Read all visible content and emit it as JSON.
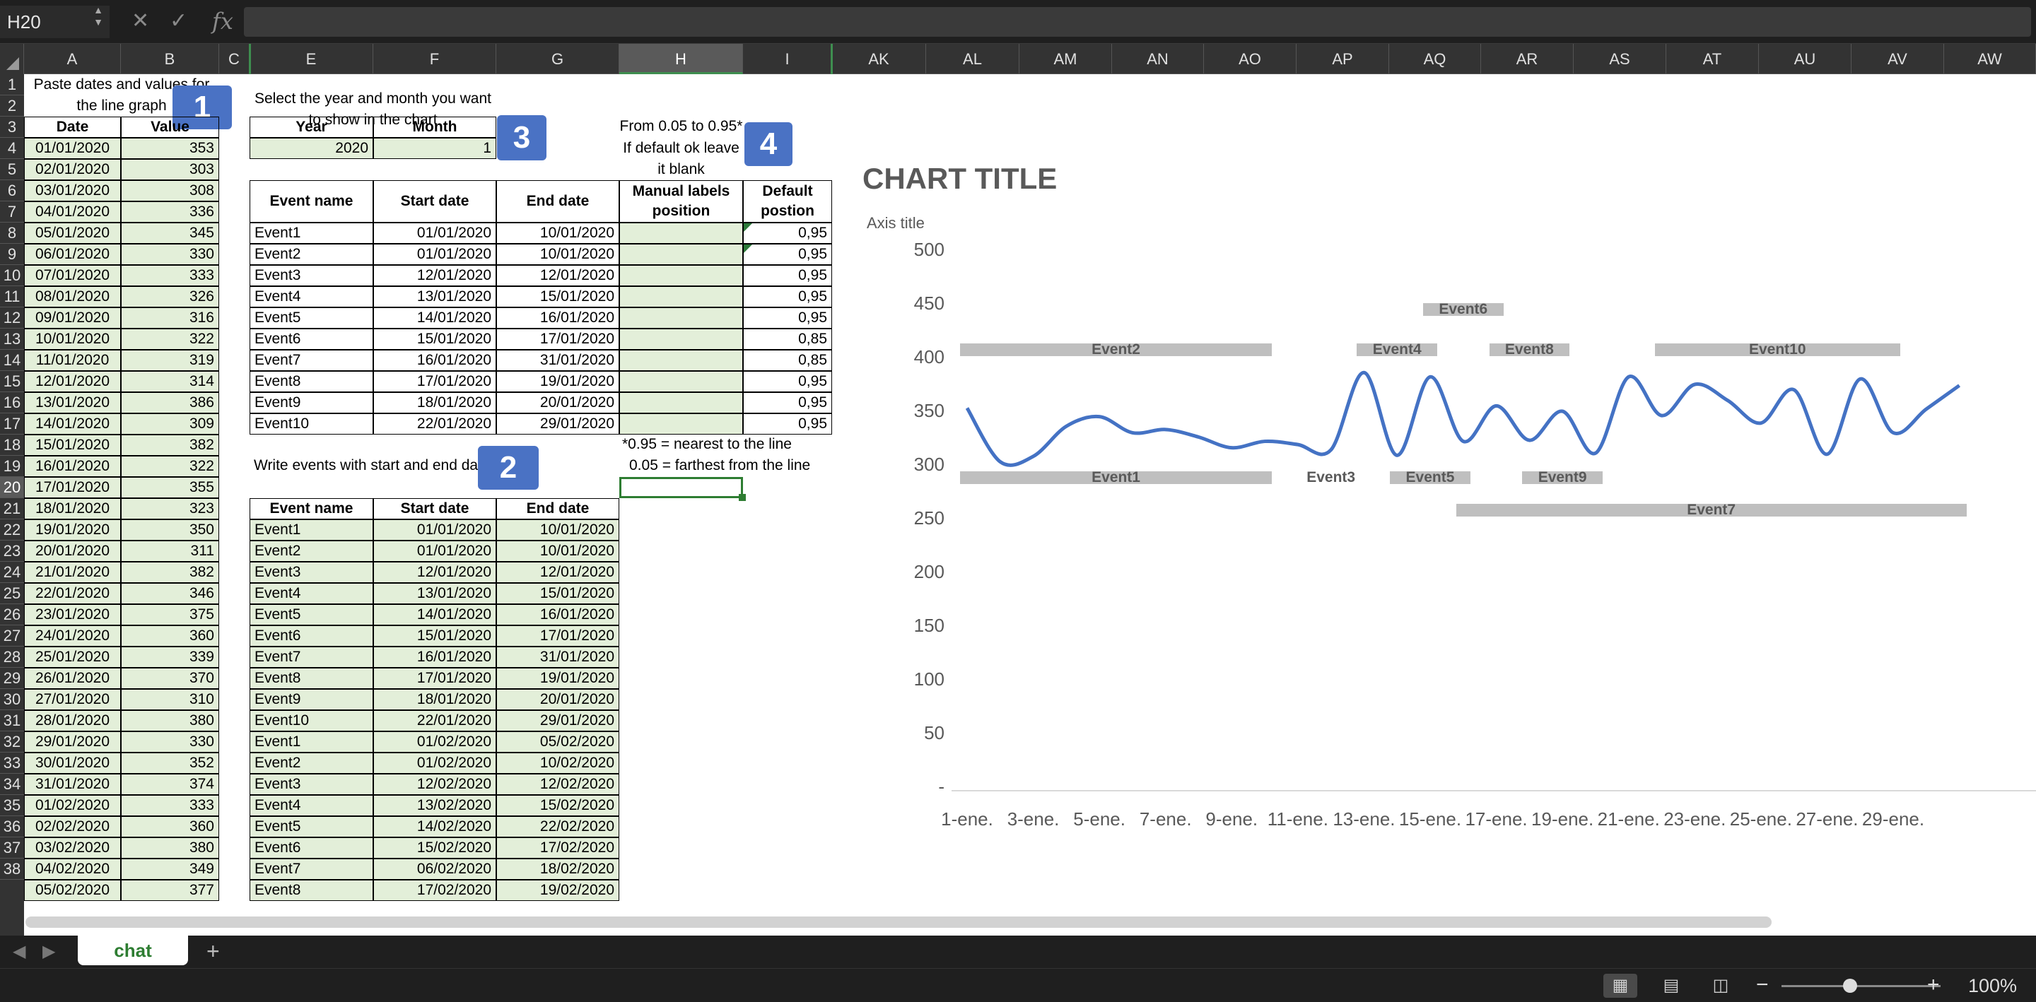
{
  "formula_bar": {
    "cell_ref": "H20",
    "fx_label": "fx",
    "cancel_icon": "close-icon",
    "enter_icon": "check-icon",
    "formula": ""
  },
  "columns": [
    "A",
    "B",
    "C",
    "E",
    "F",
    "G",
    "H",
    "I",
    "AK",
    "AL",
    "AM",
    "AN",
    "AO",
    "AP",
    "AQ",
    "AR",
    "AS",
    "AT",
    "AU",
    "AV",
    "AW"
  ],
  "selected_column": "H",
  "selected_row": "20",
  "rows": [
    "1",
    "2",
    "3",
    "4",
    "5",
    "6",
    "7",
    "8",
    "9",
    "10",
    "11",
    "12",
    "13",
    "14",
    "15",
    "16",
    "17",
    "18",
    "19",
    "20",
    "21",
    "22",
    "23",
    "24",
    "25",
    "26",
    "27",
    "28",
    "29",
    "30",
    "31",
    "32",
    "33",
    "34",
    "35",
    "36",
    "37",
    "38"
  ],
  "notes": {
    "paste_instructions": "Paste dates and values for the line graph",
    "select_instructions": "Select the year and month you want to show in the chart",
    "range_note": "From 0.05 to 0.95*",
    "default_note": "If default ok leave it blank",
    "nearest_note": "*0.95 = nearest to the line",
    "farthest_note": "0.05 = farthest from the line",
    "write_events": "Write events with start and end dat"
  },
  "badges": {
    "b1": "1",
    "b2": "2",
    "b3": "3",
    "b4": "4"
  },
  "data_table": {
    "headers": [
      "Date",
      "Value"
    ],
    "rows": [
      [
        "01/01/2020",
        "353"
      ],
      [
        "02/01/2020",
        "303"
      ],
      [
        "03/01/2020",
        "308"
      ],
      [
        "04/01/2020",
        "336"
      ],
      [
        "05/01/2020",
        "345"
      ],
      [
        "06/01/2020",
        "330"
      ],
      [
        "07/01/2020",
        "333"
      ],
      [
        "08/01/2020",
        "326"
      ],
      [
        "09/01/2020",
        "316"
      ],
      [
        "10/01/2020",
        "322"
      ],
      [
        "11/01/2020",
        "319"
      ],
      [
        "12/01/2020",
        "314"
      ],
      [
        "13/01/2020",
        "386"
      ],
      [
        "14/01/2020",
        "309"
      ],
      [
        "15/01/2020",
        "382"
      ],
      [
        "16/01/2020",
        "322"
      ],
      [
        "17/01/2020",
        "355"
      ],
      [
        "18/01/2020",
        "323"
      ],
      [
        "19/01/2020",
        "350"
      ],
      [
        "20/01/2020",
        "311"
      ],
      [
        "21/01/2020",
        "382"
      ],
      [
        "22/01/2020",
        "346"
      ],
      [
        "23/01/2020",
        "375"
      ],
      [
        "24/01/2020",
        "360"
      ],
      [
        "25/01/2020",
        "339"
      ],
      [
        "26/01/2020",
        "370"
      ],
      [
        "27/01/2020",
        "310"
      ],
      [
        "28/01/2020",
        "380"
      ],
      [
        "29/01/2020",
        "330"
      ],
      [
        "30/01/2020",
        "352"
      ],
      [
        "31/01/2020",
        "374"
      ],
      [
        "01/02/2020",
        "333"
      ],
      [
        "02/02/2020",
        "360"
      ],
      [
        "03/02/2020",
        "380"
      ],
      [
        "04/02/2020",
        "349"
      ],
      [
        "05/02/2020",
        "377"
      ]
    ]
  },
  "period": {
    "headers": [
      "Year",
      "Month"
    ],
    "year": "2020",
    "month": "1"
  },
  "events_chart_table": {
    "headers": [
      "Event name",
      "Start date",
      "End date",
      "Manual labels position",
      "Default postion"
    ],
    "rows": [
      [
        "Event1",
        "01/01/2020",
        "10/01/2020",
        "",
        "0,95"
      ],
      [
        "Event2",
        "01/01/2020",
        "10/01/2020",
        "",
        "0,95"
      ],
      [
        "Event3",
        "12/01/2020",
        "12/01/2020",
        "",
        "0,95"
      ],
      [
        "Event4",
        "13/01/2020",
        "15/01/2020",
        "",
        "0,95"
      ],
      [
        "Event5",
        "14/01/2020",
        "16/01/2020",
        "",
        "0,95"
      ],
      [
        "Event6",
        "15/01/2020",
        "17/01/2020",
        "",
        "0,85"
      ],
      [
        "Event7",
        "16/01/2020",
        "31/01/2020",
        "",
        "0,85"
      ],
      [
        "Event8",
        "17/01/2020",
        "19/01/2020",
        "",
        "0,95"
      ],
      [
        "Event9",
        "18/01/2020",
        "20/01/2020",
        "",
        "0,95"
      ],
      [
        "Event10",
        "22/01/2020",
        "29/01/2020",
        "",
        "0,95"
      ]
    ]
  },
  "events_input_table": {
    "headers": [
      "Event name",
      "Start date",
      "End date"
    ],
    "rows": [
      [
        "Event1",
        "01/01/2020",
        "10/01/2020"
      ],
      [
        "Event2",
        "01/01/2020",
        "10/01/2020"
      ],
      [
        "Event3",
        "12/01/2020",
        "12/01/2020"
      ],
      [
        "Event4",
        "13/01/2020",
        "15/01/2020"
      ],
      [
        "Event5",
        "14/01/2020",
        "16/01/2020"
      ],
      [
        "Event6",
        "15/01/2020",
        "17/01/2020"
      ],
      [
        "Event7",
        "16/01/2020",
        "31/01/2020"
      ],
      [
        "Event8",
        "17/01/2020",
        "19/01/2020"
      ],
      [
        "Event9",
        "18/01/2020",
        "20/01/2020"
      ],
      [
        "Event10",
        "22/01/2020",
        "29/01/2020"
      ],
      [
        "Event1",
        "01/02/2020",
        "05/02/2020"
      ],
      [
        "Event2",
        "01/02/2020",
        "10/02/2020"
      ],
      [
        "Event3",
        "12/02/2020",
        "12/02/2020"
      ],
      [
        "Event4",
        "13/02/2020",
        "15/02/2020"
      ],
      [
        "Event5",
        "14/02/2020",
        "22/02/2020"
      ],
      [
        "Event6",
        "15/02/2020",
        "17/02/2020"
      ],
      [
        "Event7",
        "06/02/2020",
        "18/02/2020"
      ],
      [
        "Event8",
        "17/02/2020",
        "19/02/2020"
      ]
    ]
  },
  "chart_data": {
    "type": "line",
    "title": "CHART TITLE",
    "ylabel": "Axis title",
    "xlabel": "",
    "ylim": [
      0,
      500
    ],
    "yticks": [
      "-",
      "50",
      "100",
      "150",
      "200",
      "250",
      "300",
      "350",
      "400",
      "450",
      "500"
    ],
    "xticks": [
      "1-ene.",
      "3-ene.",
      "5-ene.",
      "7-ene.",
      "9-ene.",
      "11-ene.",
      "13-ene.",
      "15-ene.",
      "17-ene.",
      "19-ene.",
      "21-ene.",
      "23-ene.",
      "25-ene.",
      "27-ene.",
      "29-ene."
    ],
    "color": "#4472c4",
    "x": [
      1,
      2,
      3,
      4,
      5,
      6,
      7,
      8,
      9,
      10,
      11,
      12,
      13,
      14,
      15,
      16,
      17,
      18,
      19,
      20,
      21,
      22,
      23,
      24,
      25,
      26,
      27,
      28,
      29,
      30,
      31
    ],
    "values": [
      353,
      303,
      308,
      336,
      345,
      330,
      333,
      326,
      316,
      322,
      319,
      314,
      386,
      309,
      382,
      322,
      355,
      323,
      350,
      311,
      382,
      346,
      375,
      360,
      339,
      370,
      310,
      380,
      330,
      352,
      374
    ],
    "events": [
      {
        "name": "Event1",
        "start": 1,
        "end": 10,
        "y": 288
      },
      {
        "name": "Event2",
        "start": 1,
        "end": 10,
        "y": 407
      },
      {
        "name": "Event3",
        "start": 12,
        "end": 12,
        "y": 288
      },
      {
        "name": "Event4",
        "start": 13,
        "end": 15,
        "y": 407
      },
      {
        "name": "Event5",
        "start": 14,
        "end": 16,
        "y": 288
      },
      {
        "name": "Event6",
        "start": 15,
        "end": 17,
        "y": 445
      },
      {
        "name": "Event7",
        "start": 16,
        "end": 31,
        "y": 258
      },
      {
        "name": "Event8",
        "start": 17,
        "end": 19,
        "y": 407
      },
      {
        "name": "Event9",
        "start": 18,
        "end": 20,
        "y": 288
      },
      {
        "name": "Event10",
        "start": 22,
        "end": 29,
        "y": 407
      }
    ]
  },
  "sheet_tabs": [
    {
      "label": "chat"
    }
  ],
  "status_bar": {
    "zoom": "100%",
    "zoom_minus": "−",
    "zoom_plus": "+",
    "add_sheet": "+"
  }
}
